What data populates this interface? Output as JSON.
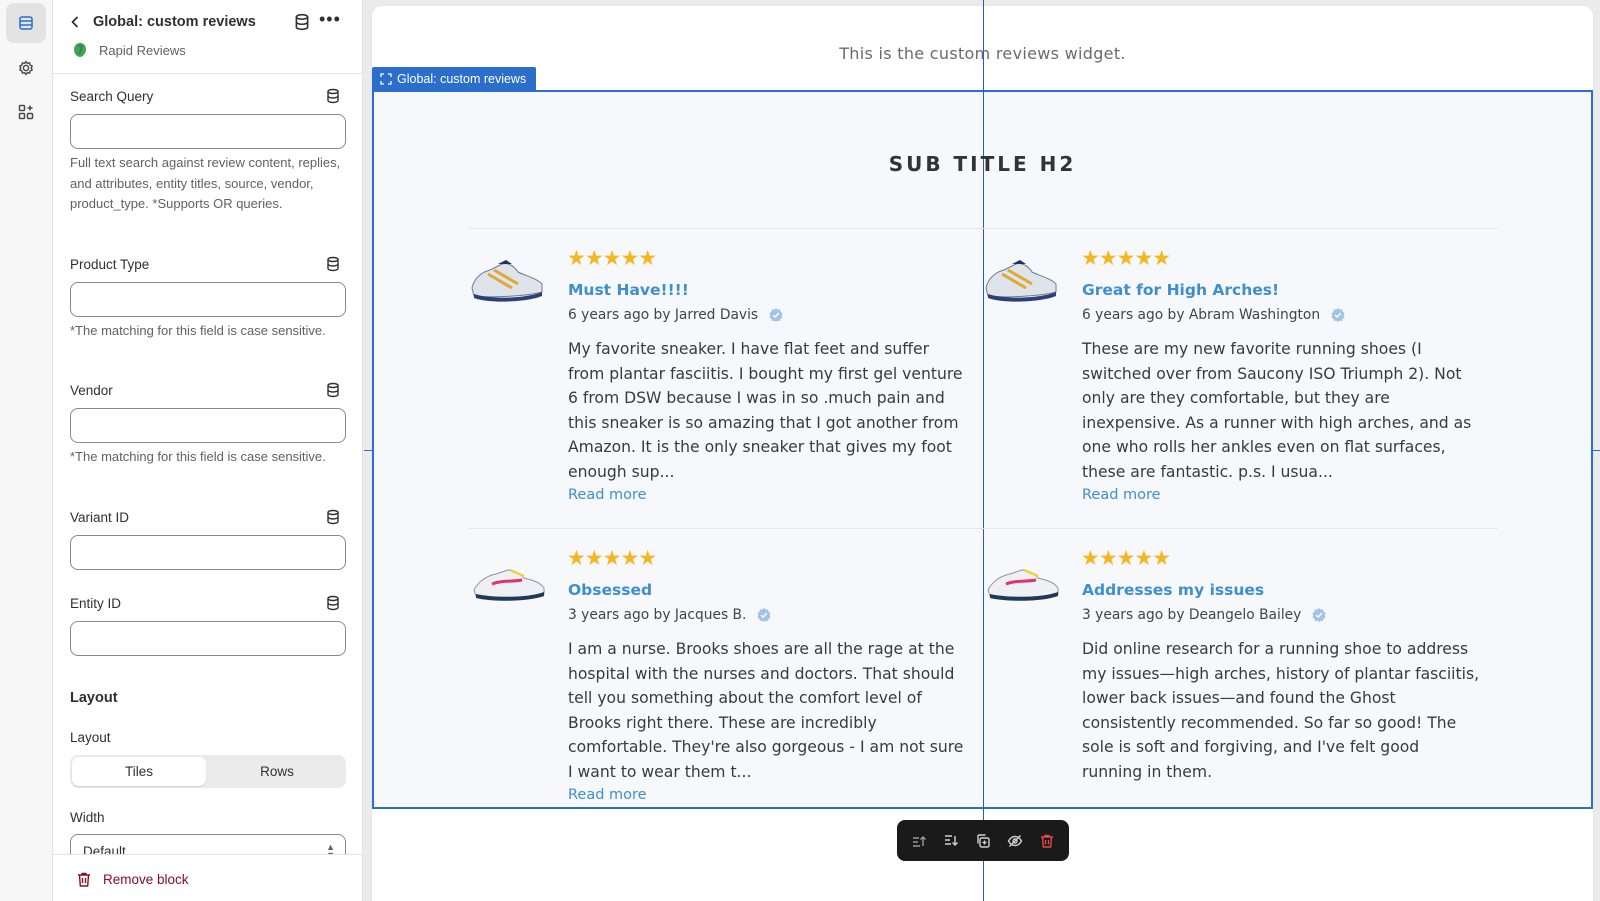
{
  "sidebar_header": {
    "title": "Global: custom reviews",
    "app_name": "Rapid Reviews"
  },
  "fields": {
    "search_query": {
      "label": "Search Query",
      "value": "",
      "help": "Full text search against review content, replies, and attributes, entity titles, source, vendor, product_type. *Supports OR queries."
    },
    "product_type": {
      "label": "Product Type",
      "value": "",
      "help": "*The matching for this field is case sensitive."
    },
    "vendor": {
      "label": "Vendor",
      "value": "",
      "help": "*The matching for this field is case sensitive."
    },
    "variant_id": {
      "label": "Variant ID",
      "value": ""
    },
    "entity_id": {
      "label": "Entity ID",
      "value": ""
    }
  },
  "layout_section": {
    "heading": "Layout",
    "layout_label": "Layout",
    "options": [
      "Tiles",
      "Rows"
    ],
    "selected": "Tiles",
    "width_label": "Width",
    "width_value": "Default"
  },
  "footer": {
    "remove_label": "Remove block"
  },
  "preview": {
    "widget_text": "This is the custom reviews widget.",
    "block_tag": "Global: custom reviews",
    "subtitle": "SUB TITLE H2",
    "reviews": [
      {
        "rating": 5,
        "stars": "★★★★★",
        "title": "Must Have!!!!",
        "meta": "6 years ago by Jarred Davis",
        "body": "My favorite sneaker. I have flat feet and suffer from plantar fasciitis. I bought my first gel venture 6 from DSW because I was in so .much pain and this sneaker is so amazing that I got another from Amazon. It is the only sneaker that gives my foot enough sup...",
        "read_more": "Read more"
      },
      {
        "rating": 5,
        "stars": "★★★★★",
        "title": "Great for High Arches!",
        "meta": "6 years ago by Abram Washington",
        "body": "These are my new favorite running shoes (I switched over from Saucony ISO Triumph 2). Not only are they comfortable, but they are inexpensive. As a runner with high arches, and as one who rolls her ankles even on flat surfaces, these are fantastic. p.s. I usua...",
        "read_more": "Read more"
      },
      {
        "rating": 5,
        "stars": "★★★★★",
        "title": "Obsessed",
        "meta": "3 years ago by Jacques B.",
        "body": "I am a nurse. Brooks shoes are all the rage at the hospital with the nurses and doctors. That should tell you something about the comfort level of Brooks right there. These are incredibly comfortable. They're also gorgeous - I am not sure I want to wear them t...",
        "read_more": "Read more"
      },
      {
        "rating": 5,
        "stars": "★★★★★",
        "title": "Addresses my issues",
        "meta": "3 years ago by Deangelo Bailey",
        "body": "Did online research for a running shoe to address my issues—high arches, history of plantar fasciitis, lower back issues—and found the Ghost consistently recommended. So far so good! The sole is soft and forgiving, and I've felt good running in them."
      }
    ]
  },
  "colors": {
    "accent": "#2c6ecb",
    "link": "#3e8fd0",
    "star": "#f5b623",
    "danger": "#8e0b21"
  }
}
